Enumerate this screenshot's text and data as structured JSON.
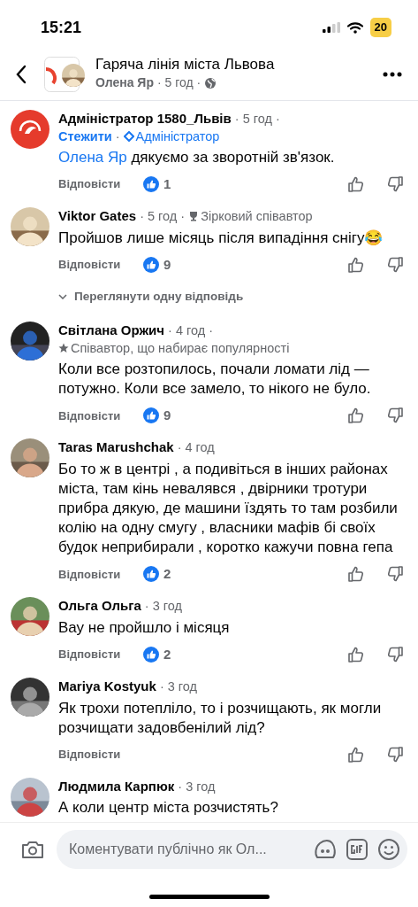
{
  "status_bar": {
    "time": "15:21",
    "battery": "20"
  },
  "header": {
    "title": "Гаряча лінія міста Львова",
    "author": "Олена Яр",
    "time": "· 5 год ·"
  },
  "comments": [
    {
      "avatar": {
        "kind": "logo"
      },
      "name": "Адміністратор 1580_Львів",
      "time": "· 5 год ·",
      "follow": "Стежити",
      "separator": "·",
      "role": {
        "kind": "admin",
        "label": "Адміністратор"
      },
      "mention": "Олена Яр",
      "text": "дякуємо за зворотній зв'язок.",
      "reply": "Відповісти",
      "likes": "1"
    },
    {
      "name": "Viktor Gates",
      "time": "· 5 год ·",
      "role": {
        "kind": "top_fan",
        "label": "Зірковий співавтор"
      },
      "text": "Пройшов лише місяць після випадіння снігу😂",
      "reply": "Відповісти",
      "likes": "9",
      "view_replies": "Переглянути одну відповідь"
    },
    {
      "name": "Світлана Оржич",
      "time": "· 4 год ·",
      "role": {
        "kind": "rising",
        "label": "Співавтор, що набирає популярності"
      },
      "text": "Коли все розтопилось, почали ломати лід — потужно. Коли все замело, то нікого не було.",
      "reply": "Відповісти",
      "likes": "9"
    },
    {
      "name": "Taras Marushchak",
      "time": "· 4 год",
      "text": "Бо то ж в центрі , а подивіться в інших районах міста, там кінь невалявся , двірники тротури прибра дякую, де машини їздять то там розбили колію на одну смугу , власники мафів бі своїх будок неприбирали , коротко кажучи повна гепа",
      "reply": "Відповісти",
      "likes": "2"
    },
    {
      "name": "Ольга Ольга",
      "time": "· 3 год",
      "text": "Вау не пройшло і місяця",
      "reply": "Відповісти",
      "likes": "2"
    },
    {
      "name": "Mariya Kostyuk",
      "time": "· 3 год",
      "text": "Як трохи потепліло, то і розчищають, як могли розчищати задовбенілий лід?",
      "reply": "Відповісти"
    },
    {
      "name": "Людмила Карпюк",
      "time": "· 3 год",
      "text": "А коли центр міста розчистять?"
    }
  ],
  "composer": {
    "placeholder": "Коментувати публічно як Ол..."
  }
}
